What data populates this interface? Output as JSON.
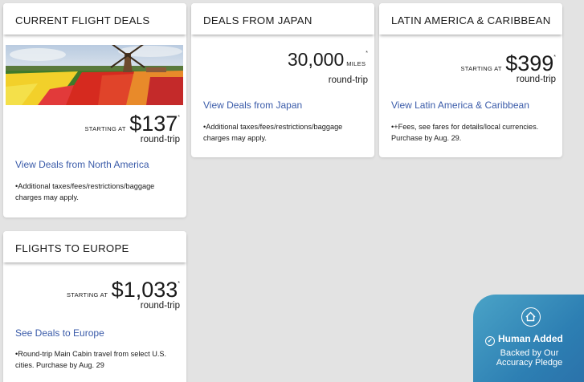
{
  "cards": {
    "current": {
      "title": "CURRENT FLIGHT DEALS",
      "starting": "STARTING AT",
      "price": "$137",
      "star": "*",
      "roundtrip": "round-trip",
      "link": "View Deals from North America",
      "note": "•Additional taxes/fees/restrictions/baggage charges may apply."
    },
    "japan": {
      "title": "DEALS FROM JAPAN",
      "price": "30,000",
      "miles": "MILES",
      "star": "*",
      "roundtrip": "round-trip",
      "link": "View Deals from Japan",
      "note": "•Additional taxes/fees/restrictions/baggage charges may apply."
    },
    "latam": {
      "title": "LATIN AMERICA & CARIBBEAN",
      "starting": "STARTING AT",
      "price": "$399",
      "star": "*",
      "roundtrip": "round-trip",
      "link": "View Latin America & Caribbean",
      "note": "•+Fees, see fares for details/local currencies. Purchase by Aug. 29."
    },
    "europe": {
      "title": "FLIGHTS TO EUROPE",
      "starting": "STARTING AT",
      "price": "$1,033",
      "star": "*",
      "roundtrip": "round-trip",
      "link": "See Deals to Europe",
      "note": "•Round-trip Main Cabin travel from select U.S. cities. Purchase by Aug. 29"
    }
  },
  "badge": {
    "title": "Human Added",
    "subtitle": "Backed by Our Accuracy Pledge"
  },
  "colors": {
    "link": "#3a5ba9",
    "page_bg": "#e3e3e3",
    "badge": "#2d7fb3"
  }
}
